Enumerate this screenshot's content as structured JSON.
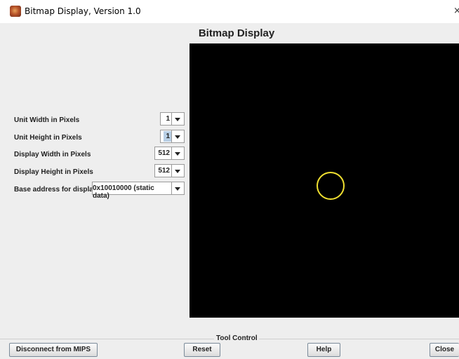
{
  "window": {
    "title": "Bitmap Display, Version 1.0",
    "close_glyph": "×"
  },
  "header": {
    "title": "Bitmap Display"
  },
  "settings": [
    {
      "label": "Unit Width in Pixels",
      "value": "1"
    },
    {
      "label": "Unit Height in Pixels",
      "value": "1"
    },
    {
      "label": "Display Width in Pixels",
      "value": "512"
    },
    {
      "label": "Display Height in Pixels",
      "value": "512"
    },
    {
      "label": "Base address for display",
      "value": "0x10010000 (static data)"
    }
  ],
  "display": {
    "background": "#000000",
    "circle_color": "#f0e030"
  },
  "tool_control": {
    "label": "Tool Control",
    "buttons": {
      "disconnect": "Disconnect from MIPS",
      "reset": "Reset",
      "help": "Help",
      "close": "Close"
    }
  }
}
